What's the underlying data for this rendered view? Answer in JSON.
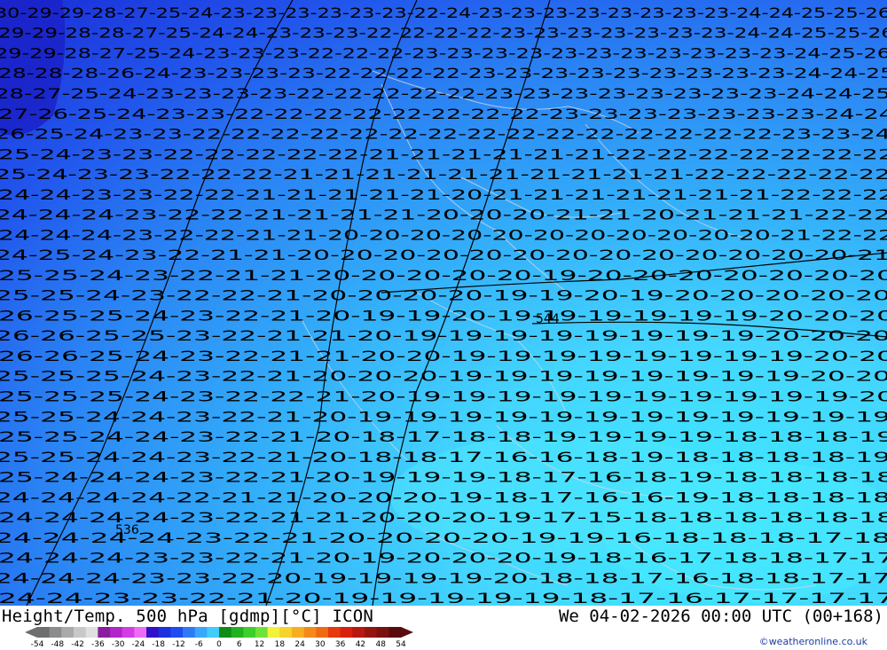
{
  "map": {
    "kind": "geopotential height / temperature field",
    "background_gradient": [
      "#1a2fd6",
      "#1f52ee",
      "#2b8bf5",
      "#3fb6fb",
      "#4ad7ff",
      "#3ee6ff"
    ],
    "isotherm_color": "#000000",
    "coast_color": "#cfcfcf",
    "special_labels": [
      {
        "text": "544"
      },
      {
        "text": "536"
      }
    ],
    "temperature_rows": [
      "30-29-29-28-27-25-24-23-23-23-23-23-23-22-24-23-23-23-23-23-23-23-23-24-24-25-25-26",
      "29-29-28-28-27-25-24-24-23-23-23-22-22-22-22-23-23-23-23-23-23-23-24-24-25-25-26",
      "29-29-28-27-25-24-23-23-23-22-22-22-23-23-23-23-23-23-23-23-23-23-23-24-25-26",
      "28-28-28-26-24-23-23-23-23-22-22-22-22-23-23-23-23-23-23-23-23-23-24-24-25",
      "28-27-25-24-23-23-23-23-22-22-22-22-22-23-23-23-23-23-23-23-23-24-24-25",
      "27-26-25-24-23-23-22-22-22-22-22-22-22-22-23-23-23-23-23-23-23-24-24",
      "26-25-24-23-23-22-22-22-22-22-22-22-22-22-22-22-22-22-22-22-23-23-24",
      "25-24-23-23-22-22-22-22-22-21-21-21-21-21-21-22-22-22-22-22-22-22",
      "25-24-23-23-22-22-22-21-21-21-21-21-21-21-21-21-21-22-22-22-22-22",
      "24-24-23-23-22-22-21-21-21-21-21-20-21-21-21-21-21-21-21-22-22-22",
      "24-24-24-23-22-22-21-21-21-21-20-20-20-21-21-20-21-21-21-22-22",
      "24-24-24-23-22-22-21-21-20-20-20-20-20-20-20-20-20-20-20-21-22-22",
      "24-25-24-23-22-21-21-20-20-20-20-20-20-20-20-20-20-20-20-20-21",
      "25-25-24-23-22-21-21-20-20-20-20-20-19-20-20-20-20-20-20-20",
      "25-25-24-23-22-22-21-20-20-20-20-19-19-20-19-20-20-20-20-20",
      "26-25-25-24-23-22-21-20-19-19-20-19-19-19-19-19-19-20-20-20",
      "26-26-25-25-23-22-21-21-20-19-19-19-19-19-19-19-19-20-20-20",
      "26-26-25-24-23-22-21-21-20-20-19-19-19-19-19-19-19-19-20-20",
      "25-25-25-24-23-22-21-20-20-20-19-19-19-19-19-19-19-19-20-20",
      "25-25-25-24-23-22-22-21-20-19-19-19-19-19-19-19-19-19-19-20",
      "25-25-24-24-23-22-21-20-19-19-19-19-19-19-19-19-19-19-19-19",
      "25-25-24-24-23-22-21-20-18-17-18-18-19-19-19-19-18-18-18-19",
      "25-25-24-24-23-22-21-20-18-18-17-16-16-18-19-18-18-18-18-19",
      "25-24-24-24-23-22-21-20-19-19-19-18-17-16-18-19-18-18-18-18",
      "24-24-24-24-22-21-21-20-20-20-19-18-17-16-16-19-18-18-18-18",
      "24-24-24-24-23-22-21-21-20-20-20-19-17-15-18-18-18-18-18-18",
      "24-24-24-24-23-22-21-20-20-20-20-19-19-16-18-18-18-17-18",
      "24-24-24-23-23-22-21-20-19-20-20-20-19-18-16-17-18-18-17-17",
      "24-24-24-23-23-22-20-19-19-19-19-20-18-18-17-16-18-18-17-17",
      "24-24-23-23-22-21-20-19-19-19-19-19-18-17-16-17-17-17-17"
    ]
  },
  "footer": {
    "title": "Height/Temp. 500 hPa [gdmp][°C] ICON",
    "datetime": "We 04-02-2026 00:00 UTC (00+168)",
    "credit": "©weatheronline.co.uk"
  },
  "legend": {
    "tick_labels": [
      "-54",
      "-48",
      "-42",
      "-36",
      "-30",
      "-24",
      "-18",
      "-12",
      "-6",
      "0",
      "6",
      "12",
      "18",
      "24",
      "30",
      "36",
      "42",
      "48",
      "54"
    ],
    "colors": [
      "#6e6e6e",
      "#8c8c8c",
      "#aaaaaa",
      "#c8c8c8",
      "#e0e0e0",
      "#8a1d9e",
      "#b026c8",
      "#d23de6",
      "#ee6cf5",
      "#3210c8",
      "#1d2fdf",
      "#1f4cf0",
      "#2f79f6",
      "#39a7fb",
      "#41cbff",
      "#0f8c14",
      "#22b21f",
      "#3dcf2c",
      "#6fe23a",
      "#f2f23a",
      "#f5d22c",
      "#f7ae22",
      "#f58a1a",
      "#f06a12",
      "#e8380e",
      "#d8200c",
      "#b81810",
      "#961410",
      "#7a1010",
      "#5a0c0c"
    ]
  }
}
